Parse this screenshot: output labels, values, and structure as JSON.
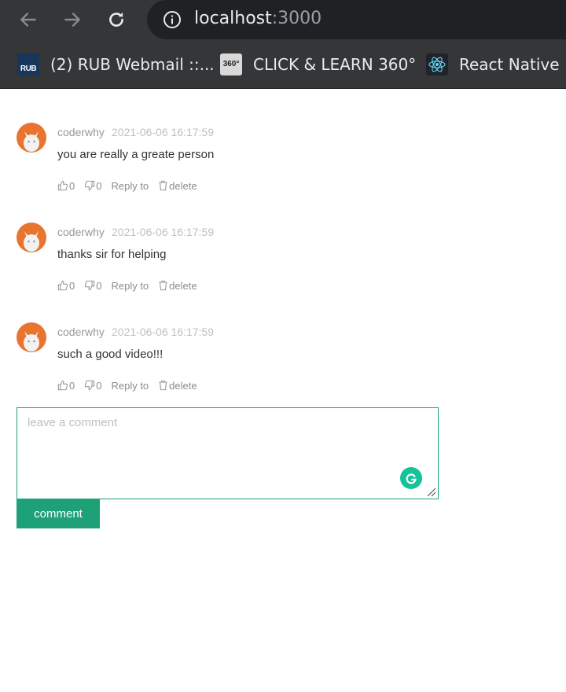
{
  "browser": {
    "url_host": "localhost",
    "url_port": ":3000",
    "bookmarks": [
      {
        "label": "(2) RUB Webmail ::...",
        "icon": "rub-favicon",
        "icon_text": "RUB"
      },
      {
        "label": "CLICK & LEARN 360°",
        "icon": "360-favicon",
        "icon_text": "360°"
      },
      {
        "label": "React Native",
        "icon": "react-favicon"
      }
    ]
  },
  "comments": [
    {
      "author": "coderwhy",
      "time": "2021-06-06 16:17:59",
      "text": "you are really a greate person",
      "likes": "0",
      "dislikes": "0",
      "reply_label": "Reply to",
      "delete_label": "delete"
    },
    {
      "author": "coderwhy",
      "time": "2021-06-06 16:17:59",
      "text": "thanks sir for helping",
      "likes": "0",
      "dislikes": "0",
      "reply_label": "Reply to",
      "delete_label": "delete"
    },
    {
      "author": "coderwhy",
      "time": "2021-06-06 16:17:59",
      "text": "such a good video!!!",
      "likes": "0",
      "dislikes": "0",
      "reply_label": "Reply to",
      "delete_label": "delete"
    }
  ],
  "editor": {
    "placeholder": "leave a comment",
    "value": "",
    "submit_label": "comment"
  },
  "colors": {
    "accent": "#1fa178",
    "avatar_bg": "#e8742f",
    "toolbar_bg": "#353638",
    "omnibox_bg": "#202124"
  }
}
